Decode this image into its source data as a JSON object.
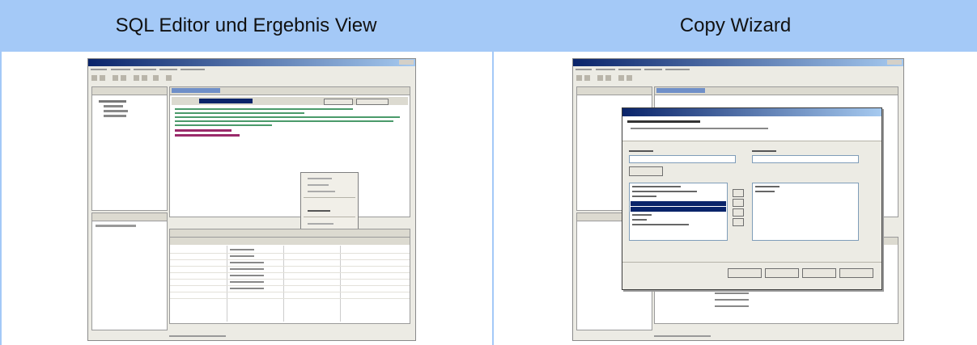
{
  "headers": {
    "left": "SQL Editor und Ergebnis View",
    "right": "Copy Wizard"
  },
  "colors": {
    "header_bg": "#a4c9f7",
    "divider": "#a4c9f7",
    "selection": "#0a246a"
  },
  "images": {
    "left": "sql-editor-screenshot-thumbnail",
    "right": "copy-wizard-screenshot-thumbnail"
  }
}
